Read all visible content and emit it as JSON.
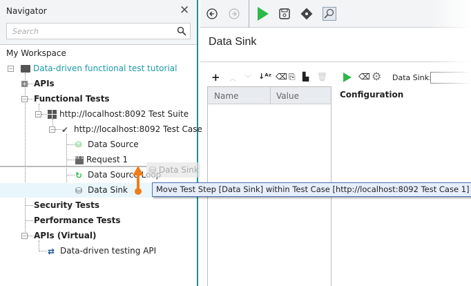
{
  "navigator": {
    "title": "Navigator",
    "search_placeholder": "Search",
    "workspace": "My Workspace",
    "project": "Data-driven functional test tutorial",
    "apis": "APIs",
    "functional_tests": "Functional Tests",
    "suite": "http://localhost:8092 Test Suite",
    "case": "http://localhost:8092 Test Case",
    "steps": [
      "Data Source",
      "Request 1",
      "Data Source Loop",
      "Data Sink"
    ],
    "security": "Security Tests",
    "performance": "Performance Tests",
    "virtual": "APIs (Virtual)",
    "virtual_api": "Data-driven testing API"
  },
  "drag": {
    "ghost_label": "Data Sink",
    "tooltip": "Move Test Step [Data Sink] within Test Case [http://localhost:8092 Test Case 1]"
  },
  "editor": {
    "title": "Data Sink",
    "columns": [
      "Name",
      "Value"
    ],
    "configuration": "Configuration",
    "sink_label": "Data Sink:",
    "sink_value": ""
  },
  "colors": {
    "accent": "#1a9aa8",
    "run": "#2eb84b",
    "drag_arrow": "#f07c1a"
  }
}
